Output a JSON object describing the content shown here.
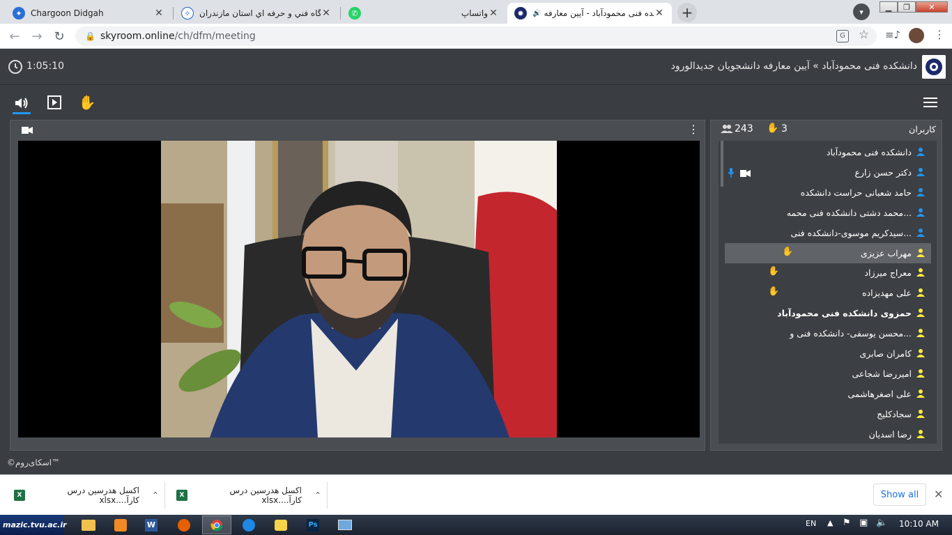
{
  "browser": {
    "tabs": [
      {
        "title": "Chargoon Didgah",
        "active": false
      },
      {
        "title": "دانشگاه فني و حرفه اي استان مازندران",
        "active": false
      },
      {
        "title": "واتساپ",
        "active": false
      },
      {
        "title": "دانشکده فنی محمودآباد - آیین معارفه",
        "active": true
      }
    ],
    "url_host": "skyroom.online",
    "url_path": "/ch/dfm/meeting"
  },
  "app": {
    "breadcrumb": "دانشکده فنی محمودآباد » آیین معارفه دانشجویان جدیدالورود",
    "timer": "1:05:10",
    "footer": "©اسکای‌روم™"
  },
  "users_panel": {
    "title": "کاربران",
    "count": "243",
    "raised_hands": "3",
    "users": [
      {
        "name": "دانشکده فنی محمودآباد",
        "role": "admin",
        "hand": false,
        "mic": false,
        "cam": false,
        "bold": false,
        "highlight": false
      },
      {
        "name": "دکتر حسن زارع",
        "role": "admin",
        "hand": false,
        "mic": true,
        "cam": true,
        "bold": false,
        "highlight": false
      },
      {
        "name": "حامد شعبانی حراست دانشکده",
        "role": "admin",
        "hand": false,
        "mic": false,
        "cam": false,
        "bold": false,
        "highlight": false
      },
      {
        "name": "محمد دشتی دانشکده فنی محمه...",
        "role": "admin",
        "hand": false,
        "mic": false,
        "cam": false,
        "bold": false,
        "highlight": false
      },
      {
        "name": "سیدکریم موسوی-دانشکده فنی...",
        "role": "admin",
        "hand": false,
        "mic": false,
        "cam": false,
        "bold": false,
        "highlight": false
      },
      {
        "name": "مهراب عزیزی",
        "role": "user",
        "hand": true,
        "mic": false,
        "cam": false,
        "bold": false,
        "highlight": true
      },
      {
        "name": "معراج میرزاد",
        "role": "user",
        "hand": true,
        "mic": false,
        "cam": false,
        "bold": false,
        "highlight": false
      },
      {
        "name": "علی مهدیزاده",
        "role": "user",
        "hand": true,
        "mic": false,
        "cam": false,
        "bold": false,
        "highlight": false
      },
      {
        "name": "حمزوی دانشکده فنی محمودآباد",
        "role": "user",
        "hand": false,
        "mic": false,
        "cam": false,
        "bold": true,
        "highlight": false
      },
      {
        "name": "محسن یوسفی- دانشکده فنی و...",
        "role": "user",
        "hand": false,
        "mic": false,
        "cam": false,
        "bold": false,
        "highlight": false
      },
      {
        "name": "کامران صابری",
        "role": "user",
        "hand": false,
        "mic": false,
        "cam": false,
        "bold": false,
        "highlight": false
      },
      {
        "name": "امیررضا شجاعی",
        "role": "user",
        "hand": false,
        "mic": false,
        "cam": false,
        "bold": false,
        "highlight": false
      },
      {
        "name": "علی اصغرهاشمی",
        "role": "user",
        "hand": false,
        "mic": false,
        "cam": false,
        "bold": false,
        "highlight": false
      },
      {
        "name": "سجادکلیج",
        "role": "user",
        "hand": false,
        "mic": false,
        "cam": false,
        "bold": false,
        "highlight": false
      },
      {
        "name": "رضا اسدیان",
        "role": "user",
        "hand": false,
        "mic": false,
        "cam": false,
        "bold": false,
        "highlight": false
      }
    ]
  },
  "downloads": [
    {
      "file": "اکسل هدرسین درس کارآ....xlsx"
    },
    {
      "file": "اکسل هدرسین درس کارآ....xlsx"
    }
  ],
  "downloads_show_all": "Show all",
  "taskbar": {
    "brand": "mazic.tvu.ac.ir",
    "lang": "EN",
    "clock": "10:10 AM"
  },
  "colors": {
    "app_bg": "#3a3d42",
    "panel_bg": "#4a4d52",
    "admin_icon": "#2196f3",
    "user_icon": "#ffeb3b"
  }
}
